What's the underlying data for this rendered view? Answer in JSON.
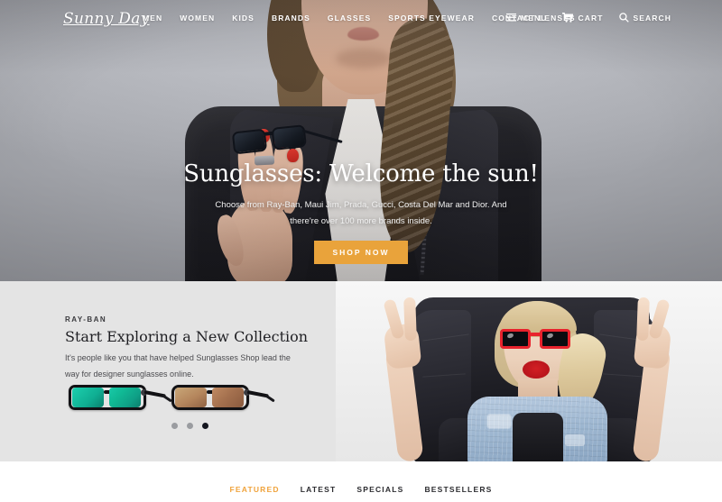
{
  "site": {
    "logo_text": "Sunny Day",
    "brand_accent": "#e9a33b",
    "tab_accent": "#f0a33c"
  },
  "nav": {
    "items": [
      {
        "label": "MEN"
      },
      {
        "label": "WOMEN"
      },
      {
        "label": "KIDS"
      },
      {
        "label": "BRANDS"
      },
      {
        "label": "GLASSES"
      },
      {
        "label": "SPORTS EYEWEAR"
      },
      {
        "label": "CONTACT LENSES"
      }
    ]
  },
  "utility": {
    "menu_label": "MENU",
    "cart_label": "CART",
    "search_label": "SEARCH"
  },
  "hero": {
    "title": "Sunglasses: Welcome the sun!",
    "subtitle": "Choose from Ray-Ban, Maui Jim, Prada, Gucci, Costa Del Mar and Dior. And there're over 100 more brands inside.",
    "cta_label": "SHOP NOW"
  },
  "promo": {
    "eyebrow": "RAY-BAN",
    "title": "Start Exploring a New Collection",
    "body": "It's people like you that have helped Sunglasses Shop lead the way for designer sunglasses online.",
    "products": [
      {
        "name": "sunglasses-green-mirror"
      },
      {
        "name": "sunglasses-copper-lens"
      }
    ],
    "carousel": {
      "total": 3,
      "active_index": 2
    }
  },
  "product_tabs": {
    "items": [
      {
        "label": "FEATURED",
        "active": true
      },
      {
        "label": "LATEST",
        "active": false
      },
      {
        "label": "SPECIALS",
        "active": false
      },
      {
        "label": "BESTSELLERS",
        "active": false
      }
    ]
  }
}
